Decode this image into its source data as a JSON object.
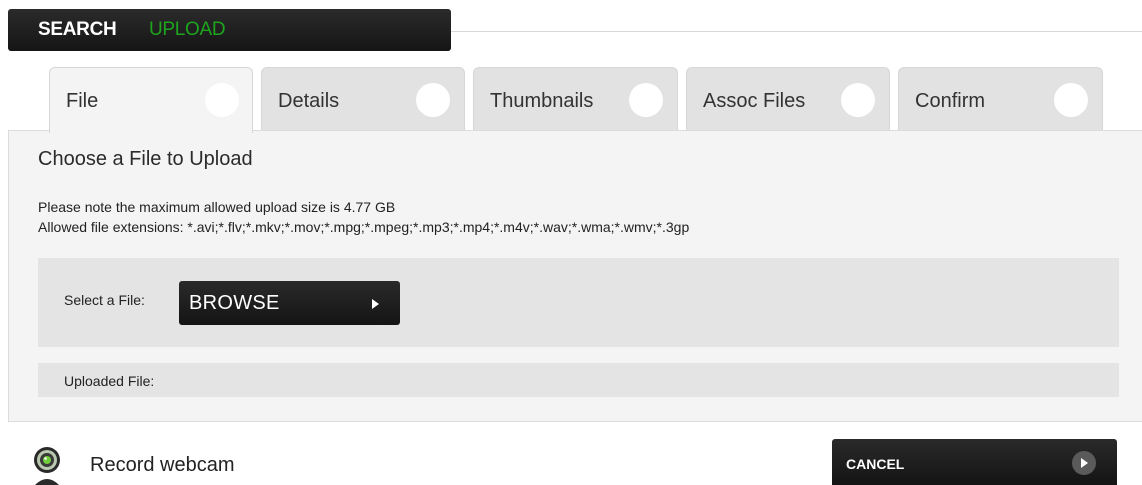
{
  "topnav": {
    "search_label": "SEARCH",
    "upload_label": "UPLOAD",
    "upload_color": "#1ea51e"
  },
  "tabs": [
    {
      "label": "File",
      "active": true
    },
    {
      "label": "Details",
      "active": false
    },
    {
      "label": "Thumbnails",
      "active": false
    },
    {
      "label": "Assoc Files",
      "active": false
    },
    {
      "label": "Confirm",
      "active": false
    }
  ],
  "panel": {
    "title": "Choose a File to Upload",
    "note_size": "Please note the maximum allowed upload size is 4.77 GB",
    "note_extensions": "Allowed file extensions: *.avi;*.flv;*.mkv;*.mov;*.mpg;*.mpeg;*.mp3;*.mp4;*.m4v;*.wav;*.wma;*.wmv;*.3gp",
    "select_label": "Select a File:",
    "browse_label": "BROWSE",
    "uploaded_label": "Uploaded File:"
  },
  "footer": {
    "webcam_label": "Record webcam",
    "webcam_icon": "webcam-icon",
    "cancel_label": "CANCEL"
  }
}
